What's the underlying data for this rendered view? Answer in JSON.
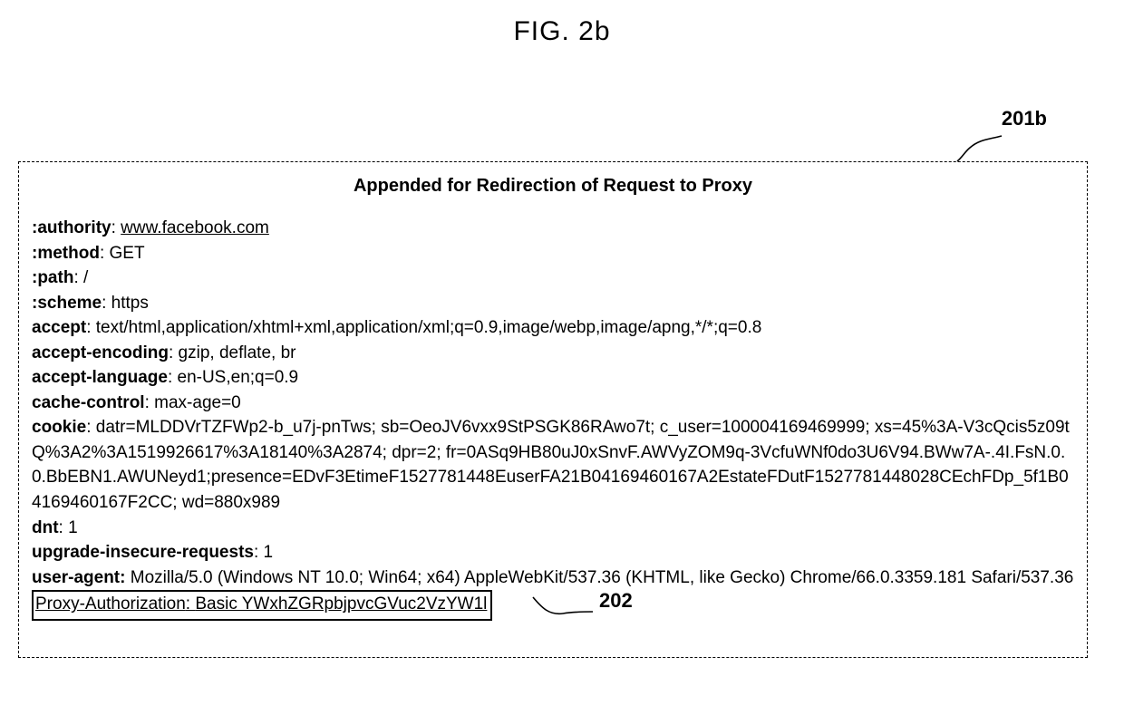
{
  "figure_label": "FIG. 2b",
  "callouts": {
    "top": "201b",
    "bottom": "202"
  },
  "box_title": "Appended for Redirection of Request  to Proxy",
  "headers": {
    "authority_key": ":authority",
    "authority_val": "www.facebook.com",
    "method_key": ":method",
    "method_val": "GET",
    "path_key": ":path",
    "path_val": "/",
    "scheme_key": ":scheme",
    "scheme_val": "https",
    "accept_key": "accept",
    "accept_val": "text/html,application/xhtml+xml,application/xml;q=0.9,image/webp,image/apng,*/*;q=0.8",
    "accept_encoding_key": "accept-encoding",
    "accept_encoding_val": "gzip, deflate, br",
    "accept_language_key": "accept-language",
    "accept_language_val": "en-US,en;q=0.9",
    "cache_control_key": "cache-control",
    "cache_control_val": "max-age=0",
    "cookie_key": "cookie",
    "cookie_val": "datr=MLDDVrTZFWp2-b_u7j-pnTws; sb=OeoJV6vxx9StPSGK86RAwo7t; c_user=100004169469999; xs=45%3A-V3cQcis5z09tQ%3A2%3A1519926617%3A18140%3A2874; dpr=2; fr=0ASq9HB80uJ0xSnvF.AWVyZOM9q-3VcfuWNf0do3U6V94.BWw7A-.4I.FsN.0.0.BbEBN1.AWUNeyd1;presence=EDvF3EtimeF1527781448EuserFA21B04169460167A2EstateFDutF1527781448028CEchFDp_5f1B04169460167F2CC; wd=880x989",
    "dnt_key": "dnt",
    "dnt_val": "1",
    "upgrade_key": "upgrade-insecure-requests",
    "upgrade_val": "1",
    "user_agent_key": "user-agent:",
    "user_agent_val": "Mozilla/5.0 (Windows NT 10.0; Win64; x64) AppleWebKit/537.36 (KHTML, like Gecko) Chrome/66.0.3359.181 Safari/537.36",
    "proxy_auth_key": "Proxy-Authorization",
    "proxy_auth_val": "Basic YWxhZGRpbjpvcGVuc2VzYW1l"
  }
}
